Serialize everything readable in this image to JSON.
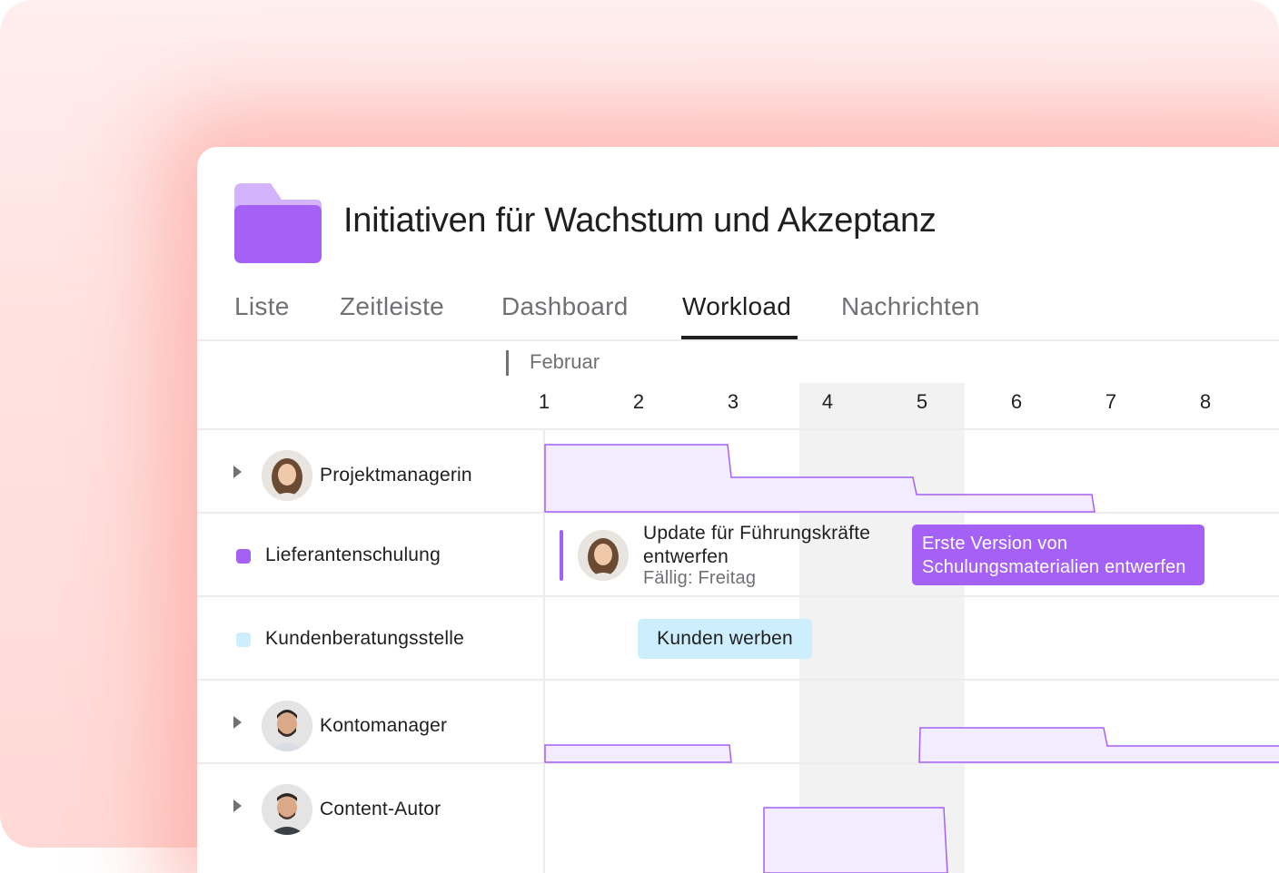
{
  "project": {
    "title": "Initiativen für Wachstum und Akzeptanz",
    "icon": "folder-icon",
    "icon_color": "#a561f5"
  },
  "tabs": [
    {
      "label": "Liste",
      "active": false
    },
    {
      "label": "Zeitleiste",
      "active": false
    },
    {
      "label": "Dashboard",
      "active": false
    },
    {
      "label": "Workload",
      "active": true
    },
    {
      "label": "Nachrichten",
      "active": false
    }
  ],
  "timeline": {
    "month": "Februar",
    "days": [
      "1",
      "2",
      "3",
      "4",
      "5",
      "6",
      "7",
      "8"
    ]
  },
  "rows": [
    {
      "label": "Projektmanagerin",
      "type": "person"
    },
    {
      "label": "Lieferantenschulung",
      "type": "project",
      "color": "#a561f5"
    },
    {
      "label": "Kundenberatungsstelle",
      "type": "project",
      "color": "#cdeffd"
    },
    {
      "label": "Kontomanager",
      "type": "person"
    },
    {
      "label": "Content-Autor",
      "type": "person"
    }
  ],
  "tasks": {
    "update": {
      "line1": "Update für Führungskräfte",
      "line2": "entwerfen",
      "due": "Fällig: Freitag"
    },
    "erste": {
      "line1": "Erste Version von",
      "line2": "Schulungsmaterialien entwerfen",
      "color": "#a561f5"
    },
    "kunden": {
      "label": "Kunden werben",
      "color": "#cdeffd"
    }
  },
  "colors": {
    "accent": "#a561f5",
    "workload_fill": "#f3ebff",
    "background_pink": "#ffe2e0"
  }
}
